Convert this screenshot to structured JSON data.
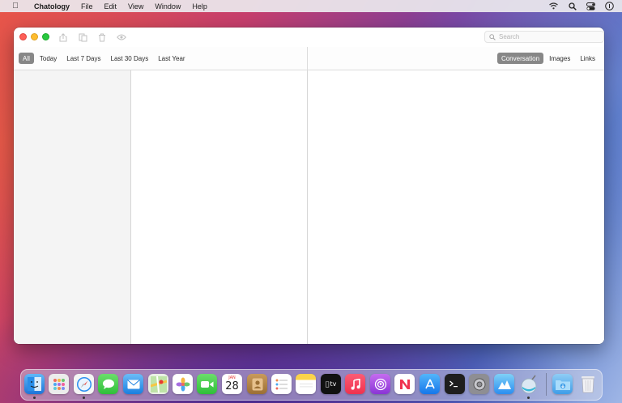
{
  "menubar": {
    "app_name": "Chatology",
    "menus": [
      "File",
      "Edit",
      "View",
      "Window",
      "Help"
    ]
  },
  "window": {
    "search": {
      "placeholder": "Search"
    },
    "filters": [
      "All",
      "Today",
      "Last 7 Days",
      "Last 30 Days",
      "Last Year"
    ],
    "active_filter": "All",
    "view_tabs": [
      "Conversation",
      "Images",
      "Links"
    ],
    "active_view_tab": "Conversation"
  },
  "dock": {
    "calendar": {
      "month": "JAN",
      "day": "28"
    },
    "tv_label": "tv"
  },
  "colors": {
    "close": "#fe5f57",
    "minimize": "#febc2e",
    "maximize": "#28c840",
    "active_pill": "#878787"
  }
}
